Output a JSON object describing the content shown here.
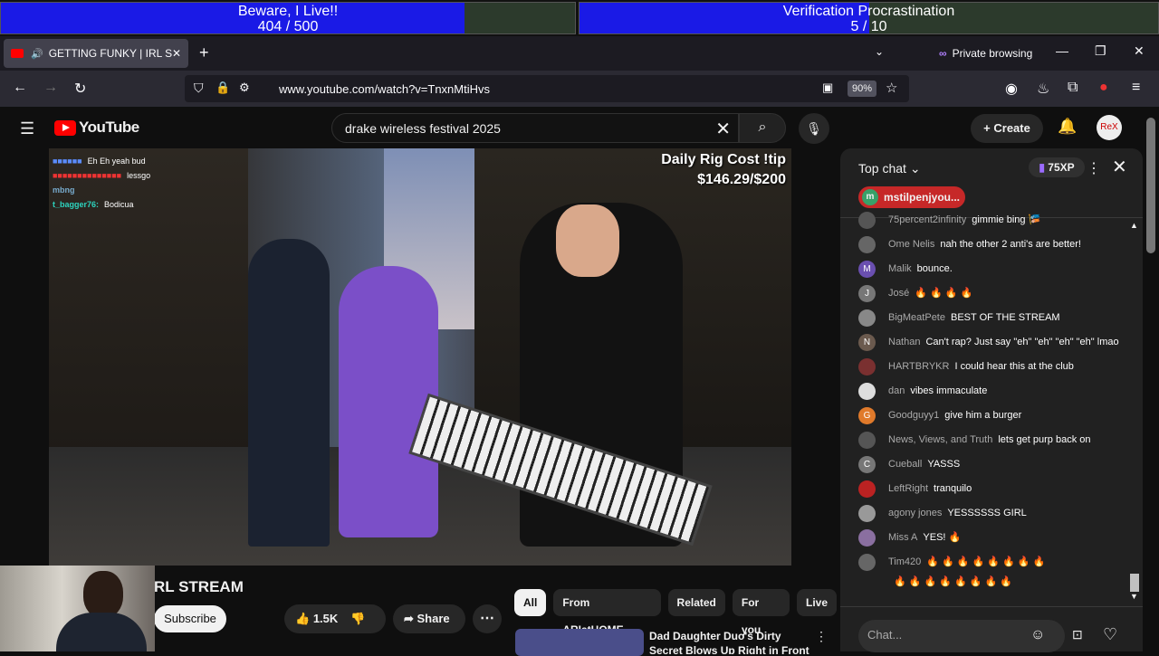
{
  "goals": [
    {
      "title": "Beware, I Live!!",
      "current": 404,
      "total": 500,
      "count": "404 / 500"
    },
    {
      "title": "Verification Procrastination",
      "current": 5,
      "total": 10,
      "count": "5 / 10"
    }
  ],
  "browser": {
    "tab_title": "GETTING FUNKY | IRL STRE",
    "private_label": "Private browsing",
    "url": "www.youtube.com/watch?v=TnxnMtiHvs",
    "zoom": "90%"
  },
  "youtube": {
    "logo_text": "YouTube",
    "search_value": "drake wireless festival 2025",
    "create_label": "Create",
    "avatar_text": "ReX"
  },
  "video": {
    "tip_title": "Daily Rig Cost !tip",
    "tip_amount": "$146.29/$200",
    "overlay_chat": [
      {
        "name": "",
        "text": "Eh Eh yeah bud"
      },
      {
        "name": "",
        "text": "lessgo"
      },
      {
        "name": "mbng",
        "text": ""
      },
      {
        "name": "t_bagger76:",
        "text": "Bodicua"
      }
    ]
  },
  "below": {
    "title_fragment": "RL STREAM",
    "subscribe": "Subscribe",
    "likes": "1.5K",
    "share": "Share",
    "chips": [
      "All",
      "From ARIatHOME",
      "Related",
      "For you",
      "Live"
    ],
    "rec_title": "Dad Daughter Duo's Dirty Secret Blows Up Right in Front of Cops"
  },
  "chat": {
    "header": "Top chat",
    "xp": "75XP",
    "pinned": "mstilpenjyou...",
    "placeholder": "Chat...",
    "messages": [
      {
        "name": "75percent2infinity",
        "text": "gimmie bing 🎏",
        "av": "#555",
        "letter": ""
      },
      {
        "name": "Ome Nelis",
        "text": "nah the other 2 anti's are better!",
        "av": "#666",
        "letter": ""
      },
      {
        "name": "Malik",
        "text": "bounce.",
        "av": "#6a4fb0",
        "letter": "M"
      },
      {
        "name": "José",
        "text": "🔥 🔥 🔥 🔥",
        "av": "#777",
        "letter": "J"
      },
      {
        "name": "BigMeatPete",
        "text": "BEST OF THE STREAM",
        "av": "#888",
        "letter": ""
      },
      {
        "name": "Nathan",
        "text": "Can't rap? Just say \"eh\" \"eh\" \"eh\" \"eh\" lmao",
        "av": "#6b5a4e",
        "letter": "N"
      },
      {
        "name": "HARTBRYKR",
        "text": "I could hear this at the club",
        "av": "#7a3030",
        "letter": ""
      },
      {
        "name": "dan",
        "text": "vibes immaculate",
        "av": "#ddd",
        "letter": ""
      },
      {
        "name": "Goodguyy1",
        "text": "give him a burger",
        "av": "#e07a2b",
        "letter": "G"
      },
      {
        "name": "News, Views, and Truth",
        "text": "lets get purp back on",
        "av": "#555",
        "letter": ""
      },
      {
        "name": "Cueball",
        "text": "YASSS",
        "av": "#777",
        "letter": "C"
      },
      {
        "name": "LeftRight",
        "text": "tranquilo",
        "av": "#b22",
        "letter": ""
      },
      {
        "name": "agony jones",
        "text": "YESSSSSS GIRL",
        "av": "#999",
        "letter": ""
      },
      {
        "name": "Miss A",
        "text": "YES! 🔥",
        "av": "#8a6fa0",
        "letter": ""
      },
      {
        "name": "Tim420",
        "text": "🔥 🔥 🔥 🔥 🔥 🔥 🔥 🔥",
        "av": "#666",
        "letter": ""
      },
      {
        "name": "",
        "text": "🔥 🔥 🔥 🔥 🔥 🔥 🔥 🔥",
        "av": "",
        "letter": ""
      }
    ]
  }
}
